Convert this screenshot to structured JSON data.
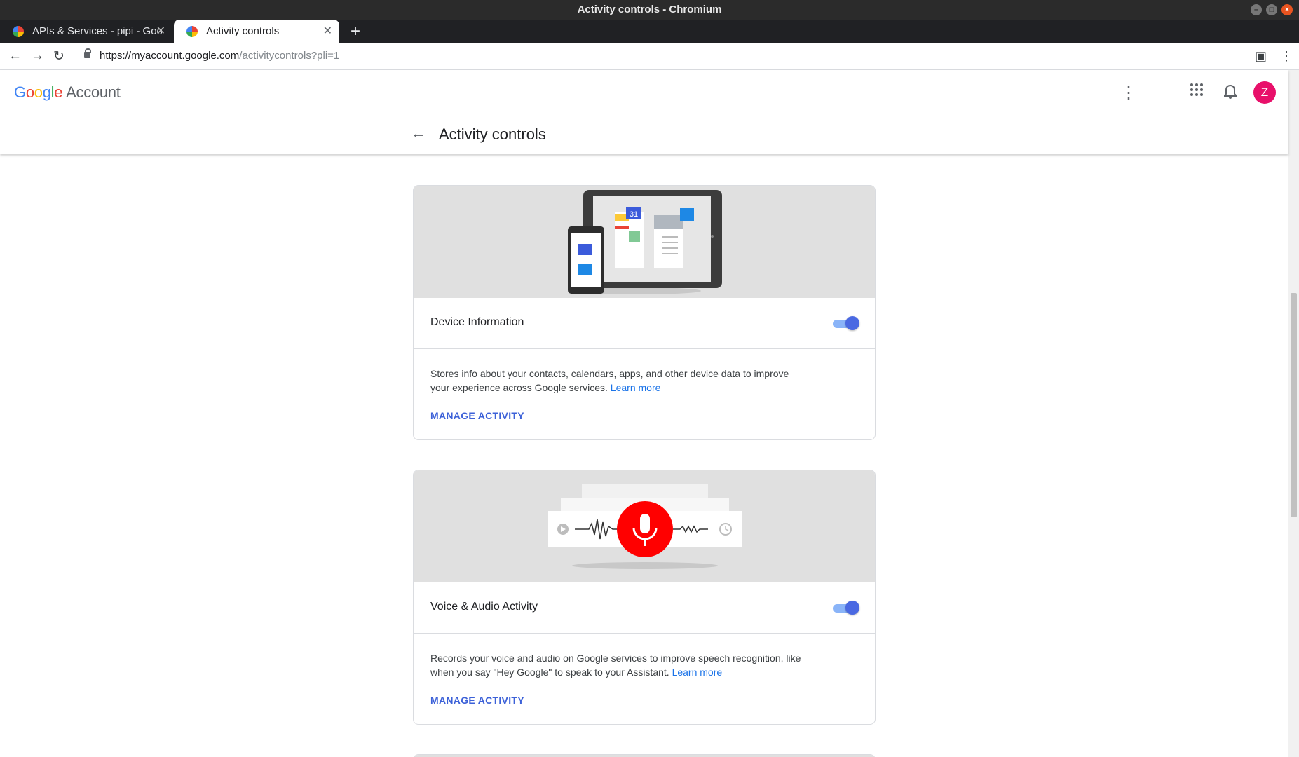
{
  "window": {
    "title": "Activity controls - Chromium"
  },
  "tabs": [
    {
      "label": "APIs & Services - pipi - Goo",
      "active": false
    },
    {
      "label": "Activity controls",
      "active": true
    }
  ],
  "toolbar": {
    "url_host": "https://myaccount.google.com",
    "url_path": "/activitycontrols?pli=1"
  },
  "header": {
    "logo_text": "Google",
    "account_label": "Account",
    "avatar_letter": "Z",
    "page_title": "Activity controls"
  },
  "cards": [
    {
      "title": "Device Information",
      "enabled": true,
      "description": "Stores info about your contacts, calendars, apps, and other device data to improve your experience across Google services.",
      "learn_more": "Learn more",
      "manage": "MANAGE ACTIVITY",
      "calendar_day": "31"
    },
    {
      "title": "Voice & Audio Activity",
      "enabled": true,
      "description": "Records your voice and audio on Google services to improve speech recognition, like when you say \"Hey Google\" to speak to your Assistant.",
      "learn_more": "Learn more",
      "manage": "MANAGE ACTIVITY"
    }
  ],
  "colors": {
    "accent": "#3c61d8",
    "toggle_on": "#4a69e2",
    "avatar": "#e8106a",
    "mic": "#ff0000"
  }
}
